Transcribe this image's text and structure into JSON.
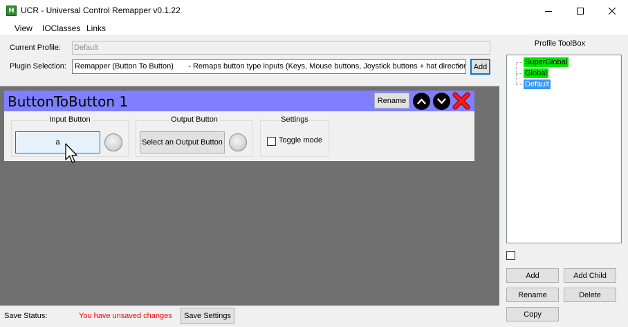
{
  "window": {
    "title": "UCR - Universal Control Remapper v0.1.22",
    "icon_letter": "H",
    "icon": "app-icon",
    "controls": [
      "minimize-icon",
      "maximize-icon",
      "close-icon"
    ]
  },
  "menu": {
    "items": [
      "View",
      "IOClasses",
      "Links"
    ]
  },
  "profile": {
    "current_label": "Current Profile:",
    "current_value": "Default",
    "plugin_label": "Plugin Selection:",
    "plugin_selected": "Remapper (Button To Button)       - Remaps button type inputs (Keys, Mouse buttons, Joystick buttons + hat directions)",
    "add_label": "Add"
  },
  "plugin": {
    "title": "ButtonToButton 1",
    "header_color": "#7e80ff",
    "rename_label": "Rename",
    "input_group_label": "Input Button",
    "input_value": "a",
    "output_group_label": "Output Button",
    "output_button_label": "Select an Output Button",
    "settings_group_label": "Settings",
    "toggle_label": "Toggle mode",
    "toggle_checked": false,
    "icons": [
      "arrow-up-icon",
      "arrow-down-icon",
      "delete-x-icon"
    ]
  },
  "status": {
    "label": "Save Status:",
    "message": "You have unsaved changes",
    "message_color": "#ff0000",
    "save_label": "Save Settings"
  },
  "toolbox": {
    "title": "Profile ToolBox",
    "tree": [
      {
        "label": "SuperGlobal",
        "highlight": "#00e800"
      },
      {
        "label": "Global",
        "highlight": "#00e800"
      },
      {
        "label": "Default",
        "highlight": "#3399ff"
      }
    ],
    "checkbox_checked": false,
    "buttons": {
      "add": "Add",
      "add_child": "Add Child",
      "rename": "Rename",
      "delete": "Delete",
      "copy": "Copy"
    }
  }
}
